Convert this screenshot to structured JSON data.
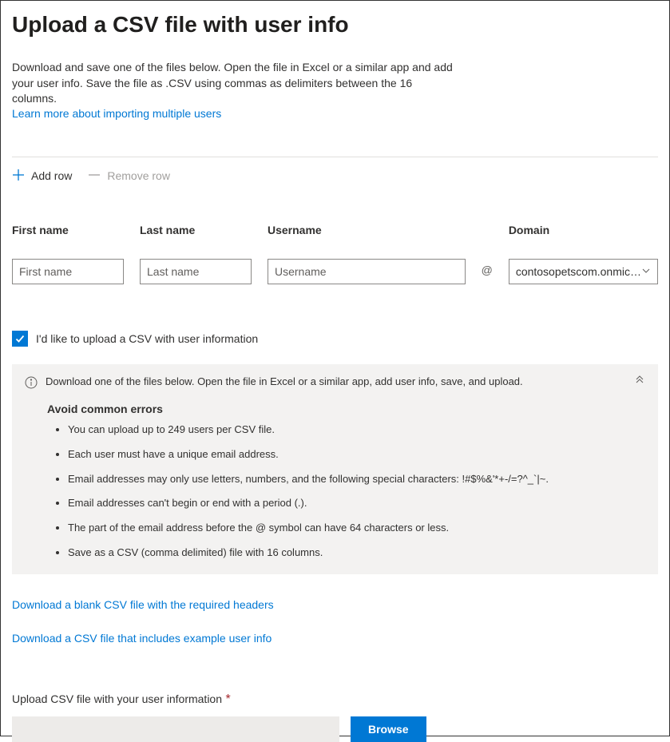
{
  "header": {
    "title": "Upload a CSV file with user info",
    "description": "Download and save one of the files below. Open the file in Excel or a similar app and add your user info. Save the file as .CSV using commas as delimiters between the 16 columns.",
    "learn_more": "Learn more about importing multiple users"
  },
  "actions": {
    "add_row": "Add row",
    "remove_row": "Remove row"
  },
  "form": {
    "first_name": {
      "label": "First name",
      "placeholder": "First name"
    },
    "last_name": {
      "label": "Last name",
      "placeholder": "Last name"
    },
    "username": {
      "label": "Username",
      "placeholder": "Username"
    },
    "at": "@",
    "domain": {
      "label": "Domain",
      "value": "contosopetscom.onmic…"
    }
  },
  "upload_toggle": {
    "label": "I'd like to upload a CSV with user information"
  },
  "panel": {
    "intro": "Download one of the files below. Open the file in Excel or a similar app, add user info, save, and upload.",
    "subtitle": "Avoid common errors",
    "items": [
      "You can upload up to 249 users per CSV file.",
      "Each user must have a unique email address.",
      "Email addresses may only use letters, numbers, and the following special characters: !#$%&'*+-/=?^_`|~.",
      "Email addresses can't begin or end with a period (.).",
      "The part of the email address before the @ symbol can have 64 characters or less.",
      "Save as a CSV (comma delimited) file with 16 columns."
    ]
  },
  "downloads": {
    "blank": "Download a blank CSV file with the required headers",
    "example": "Download a CSV file that includes example user info"
  },
  "upload": {
    "label": "Upload CSV file with your user information",
    "required_mark": "*",
    "browse": "Browse"
  }
}
